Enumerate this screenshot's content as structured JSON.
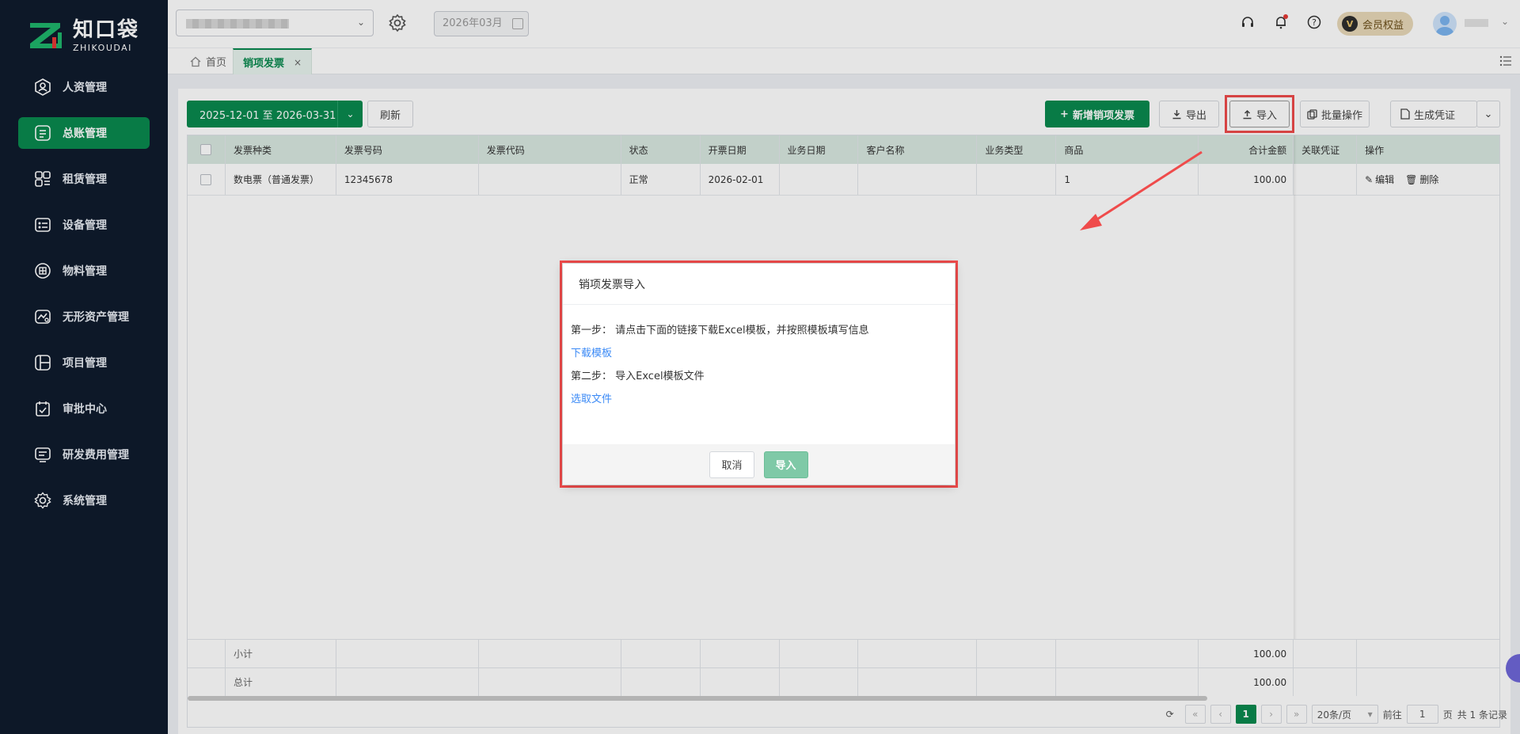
{
  "sidebar": {
    "logo_cn": "知口袋",
    "logo_en": "ZHIKOUDAI",
    "items": [
      {
        "label": "人资管理",
        "icon": "person-badge-icon"
      },
      {
        "label": "总账管理",
        "icon": "ledger-icon",
        "active": true
      },
      {
        "label": "租赁管理",
        "icon": "lease-icon"
      },
      {
        "label": "设备管理",
        "icon": "device-icon"
      },
      {
        "label": "物料管理",
        "icon": "material-icon"
      },
      {
        "label": "无形资产管理",
        "icon": "intangible-asset-icon"
      },
      {
        "label": "项目管理",
        "icon": "project-icon"
      },
      {
        "label": "审批中心",
        "icon": "approval-icon"
      },
      {
        "label": "研发费用管理",
        "icon": "rd-expense-icon"
      },
      {
        "label": "系统管理",
        "icon": "gear-icon"
      }
    ]
  },
  "header": {
    "period": "2026年03月",
    "member_badge": "V",
    "member_label": "会员权益"
  },
  "tabs": {
    "home": "首页",
    "active": "销项发票",
    "close": "×"
  },
  "toolbar": {
    "date_range": "2025-12-01 至 2026-03-31",
    "refresh": "刷新",
    "add": "新增销项发票",
    "export": "导出",
    "import": "导入",
    "batch": "批量操作",
    "voucher": "生成凭证"
  },
  "table": {
    "headers": [
      "发票种类",
      "发票号码",
      "发票代码",
      "状态",
      "开票日期",
      "业务日期",
      "客户名称",
      "业务类型",
      "商品",
      "合计金额",
      "关联凭证",
      "操作"
    ],
    "rows": [
      {
        "kind": "数电票（普通发票）",
        "number": "12345678",
        "code": "",
        "status": "正常",
        "issue_date": "2026-02-01",
        "biz_date": "",
        "customer": "",
        "biz_type": "",
        "goods": "1",
        "amount": "100.00",
        "voucher": ""
      }
    ],
    "actions": {
      "edit": "编辑",
      "delete": "删除"
    },
    "subtotal_label": "小计",
    "subtotal_amount": "100.00",
    "total_label": "总计",
    "total_amount": "100.00"
  },
  "pager": {
    "current": "1",
    "page_size": "20条/页",
    "goto_label": "前往",
    "goto_value": "1",
    "page_unit": "页",
    "summary": "共 1 条记录"
  },
  "dialog": {
    "title": "销项发票导入",
    "step1": "第一步：  请点击下面的链接下载Excel模板，并按照模板填写信息",
    "download_link": "下载模板",
    "step2": "第二步：  导入Excel模板文件",
    "choose_link": "选取文件",
    "cancel": "取消",
    "confirm": "导入"
  },
  "colors": {
    "brand": "#0a8a4f",
    "sidebar_bg": "#0f1b2d",
    "highlight": "#ef4b4b",
    "link": "#3b8af6"
  }
}
